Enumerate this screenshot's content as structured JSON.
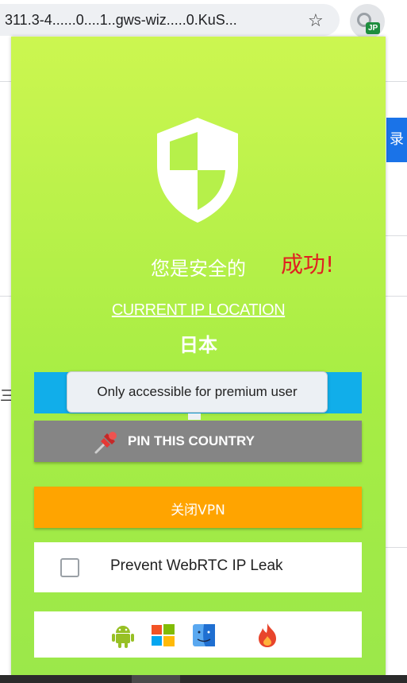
{
  "browser": {
    "url": "311.3-4......0....1..gws-wiz.....0.KuS...",
    "star_icon": "star-icon",
    "extension_badge": "JP"
  },
  "background": {
    "side_tab_char": "录",
    "left_char": "三"
  },
  "popup": {
    "status_text": "您是安全的",
    "location_label": "CURRENT IP LOCATION",
    "country": "日本",
    "tooltip": "Only accessible for premium user",
    "pin_label": "PIN THIS COUNTRY",
    "disconnect_label": "关闭VPN",
    "webrtc_label": "Prevent WebRTC IP Leak",
    "webrtc_checked": false,
    "platforms": [
      "android-icon",
      "windows-icon",
      "macos-finder-icon",
      "fire-icon"
    ],
    "colors": {
      "gradient_top": "#ccf650",
      "gradient_bottom": "#9be84a",
      "change_button": "#11aeea",
      "pin_button": "#858585",
      "disconnect_button": "#ffa400"
    }
  },
  "annotation": {
    "text": "成功!",
    "color": "#e02020"
  }
}
